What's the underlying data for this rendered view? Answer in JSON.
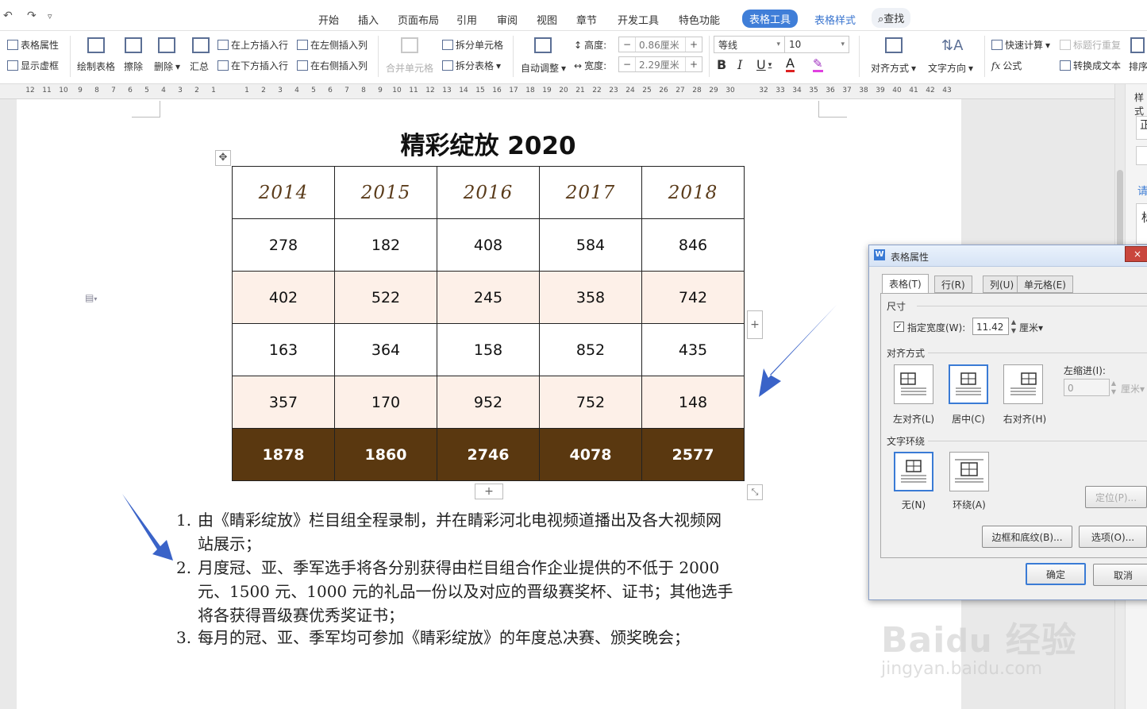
{
  "menu": {
    "items": [
      "开始",
      "插入",
      "页面布局",
      "引用",
      "审阅",
      "视图",
      "章节",
      "开发工具",
      "特色功能"
    ],
    "active": "表格工具",
    "table_style": "表格样式",
    "search": "查找"
  },
  "ribbon": {
    "table_props": "表格属性",
    "show_gridlines": "显示虚框",
    "draw_table": "绘制表格",
    "erase": "擦除",
    "delete": "删除",
    "summary": "汇总",
    "insert_above": "在上方插入行",
    "insert_below": "在下方插入行",
    "insert_left": "在左侧插入列",
    "insert_right": "在右侧插入列",
    "merge_cells": "合并单元格",
    "split_cells": "拆分单元格",
    "split_table": "拆分表格",
    "auto_fit": "自动调整",
    "height_label": "高度:",
    "height_value": "0.86厘米",
    "width_label": "宽度:",
    "width_value": "2.29厘米",
    "font_name": "等线",
    "font_size": "10",
    "align": "对齐方式",
    "text_dir": "文字方向",
    "quick_calc": "快速计算",
    "repeat_header": "标题行重复",
    "formula": "公式",
    "to_text": "转换成文本",
    "sort": "排序"
  },
  "ruler_ticks": [
    "12",
    "11",
    "10",
    "9",
    "8",
    "7",
    "6",
    "5",
    "4",
    "3",
    "2",
    "1",
    "",
    "1",
    "2",
    "3",
    "4",
    "5",
    "6",
    "7",
    "8",
    "9",
    "10",
    "11",
    "12",
    "13",
    "14",
    "15",
    "16",
    "17",
    "18",
    "19",
    "20",
    "21",
    "22",
    "23",
    "24",
    "25",
    "26",
    "27",
    "28",
    "29",
    "30",
    "",
    "32",
    "33",
    "34",
    "35",
    "36",
    "37",
    "38",
    "39",
    "40",
    "41",
    "42",
    "43"
  ],
  "doc": {
    "title": "精彩绽放 2020",
    "table": {
      "headers": [
        "2014",
        "2015",
        "2016",
        "2017",
        "2018"
      ],
      "rows": [
        [
          "278",
          "182",
          "408",
          "584",
          "846"
        ],
        [
          "402",
          "522",
          "245",
          "358",
          "742"
        ],
        [
          "163",
          "364",
          "158",
          "852",
          "435"
        ],
        [
          "357",
          "170",
          "952",
          "752",
          "148"
        ]
      ],
      "totals": [
        "1878",
        "1860",
        "2746",
        "4078",
        "2577"
      ]
    },
    "list": [
      {
        "n": "1.",
        "lines": [
          "由《睛彩绽放》栏目组全程录制，并在睛彩河北电视频道播出及各大视频网",
          "站展示；"
        ]
      },
      {
        "n": "2.",
        "lines": [
          "月度冠、亚、季军选手将各分别获得由栏目组合作企业提供的不低于 2000",
          "元、1500 元、1000 元的礼品一份以及对应的晋级赛奖杯、证书；其他选手",
          "将各获得晋级赛优秀奖证书；"
        ]
      },
      {
        "n": "3.",
        "lines": [
          "每月的冠、亚、季军均可参加《睛彩绽放》的年度总决赛、颁奖晚会；"
        ]
      }
    ]
  },
  "side_pane": {
    "a": "样式",
    "b": "正",
    "c": "请",
    "d": "标"
  },
  "dialog": {
    "title": "表格属性",
    "tabs": [
      "表格(T)",
      "行(R)",
      "列(U)",
      "单元格(E)"
    ],
    "size_group": "尺寸",
    "spec_width": "指定宽度(W):",
    "width_value": "11.42",
    "unit": "厘米",
    "align_group": "对齐方式",
    "align_left": "左对齐(L)",
    "align_center": "居中(C)",
    "align_right": "右对齐(H)",
    "indent_label": "左缩进(I):",
    "indent_value": "0",
    "indent_unit": "厘米",
    "wrap_group": "文字环绕",
    "wrap_none": "无(N)",
    "wrap_around": "环绕(A)",
    "position_btn": "定位(P)...",
    "border_btn": "边框和底纹(B)...",
    "options_btn": "选项(O)...",
    "ok": "确定",
    "cancel": "取消"
  },
  "colors": {
    "accent": "#3a7bd5",
    "total_row": "#5a3810",
    "alt_row": "#fdf0e8",
    "arrow": "#3a63c8"
  }
}
